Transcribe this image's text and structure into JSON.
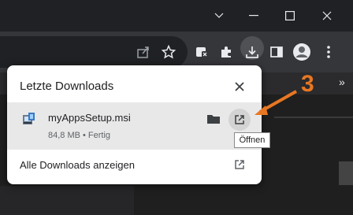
{
  "window": {
    "controls": [
      "chevron-down-icon",
      "minimize-icon",
      "maximize-icon",
      "close-icon"
    ]
  },
  "toolbar": {
    "icons": [
      "share-icon",
      "star-icon",
      "extension-badge-icon",
      "puzzle-icon",
      "download-icon",
      "sidebar-icon",
      "profile-icon",
      "menu-dots-icon"
    ],
    "overflow_glyph": "»"
  },
  "downloads": {
    "title": "Letzte Downloads",
    "items": [
      {
        "name": "myAppsSetup.msi",
        "meta": "84,8 MB • Fertig"
      }
    ],
    "show_all": "Alle Downloads anzeigen"
  },
  "tooltip": {
    "text": "Öffnen"
  },
  "annotation": {
    "number": "3",
    "color": "#e87722"
  }
}
